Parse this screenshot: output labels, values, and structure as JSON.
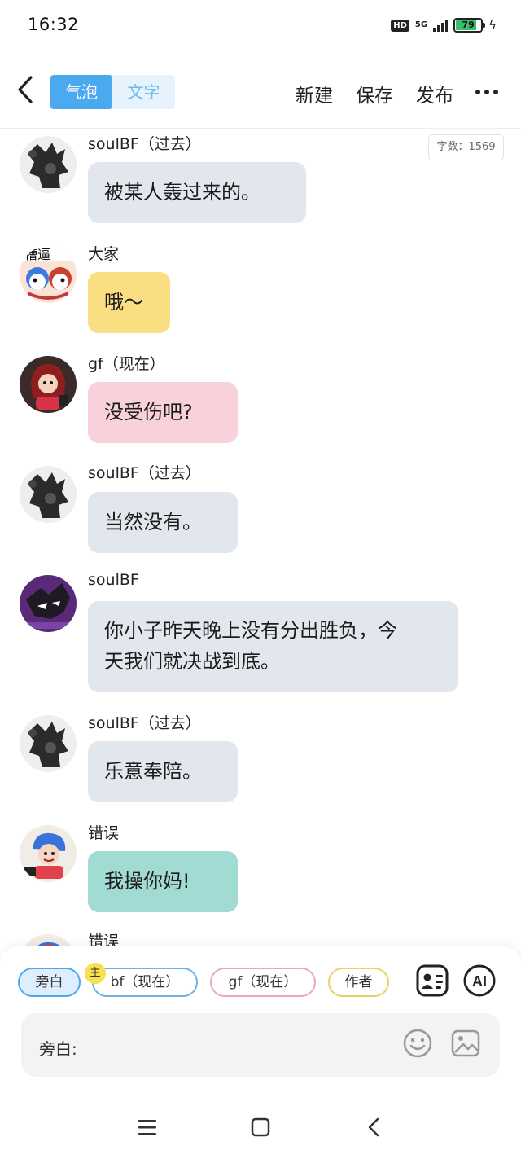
{
  "status_bar": {
    "time": "16:32",
    "hd_label": "HD",
    "network": "5G",
    "battery": "79"
  },
  "header": {
    "seg_bubble": "气泡",
    "seg_text": "文字",
    "new_label": "新建",
    "save_label": "保存",
    "publish_label": "发布"
  },
  "word_count": "字数：1569",
  "messages": [
    {
      "name": "soulBF（过去）",
      "text": "被某人轰过来的。",
      "bubble": "gray"
    },
    {
      "name": "大家",
      "text": "哦～",
      "bubble": "yellow"
    },
    {
      "name": "gf（现在）",
      "text": "没受伤吧?",
      "bubble": "pink"
    },
    {
      "name": "soulBF（过去）",
      "text": "当然没有。",
      "bubble": "gray"
    },
    {
      "name": "soulBF",
      "text_line1": "你小子昨天晚上没有分出胜负，今",
      "text_line2": "天我们就决战到底。",
      "bubble": "gray"
    },
    {
      "name": "soulBF（过去）",
      "text": "乐意奉陪。",
      "bubble": "gray"
    },
    {
      "name": "错误",
      "text": "我操你妈!",
      "bubble": "teal"
    },
    {
      "name": "错误"
    }
  ],
  "roles": {
    "narration": "旁白",
    "main_badge": "主",
    "bf_now": "bf（现在）",
    "gf_now": "gf（现在）",
    "author": "作者",
    "ai_label": "AI"
  },
  "input": {
    "placeholder": "旁白:"
  },
  "colors": {
    "accent": "#4ba9ef",
    "bubble_gray": "#e2e7ee",
    "bubble_yellow": "#fbdd82",
    "bubble_pink": "#f8d1da",
    "bubble_teal": "#a2dbd4"
  }
}
